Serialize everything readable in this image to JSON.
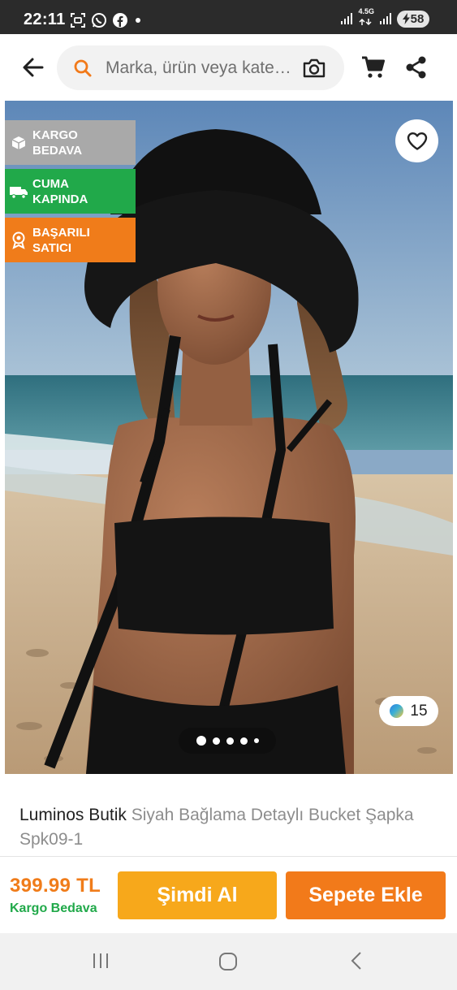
{
  "status_bar": {
    "time": "22:11",
    "network_label": "4.5G",
    "battery": "58",
    "icons": [
      "screenshot-icon",
      "whatsapp-icon",
      "facebook-icon",
      "dot-icon",
      "signal-icon",
      "network-icon",
      "battery-icon"
    ]
  },
  "header": {
    "search_placeholder": "Marka, ürün veya kategori ara",
    "icons": [
      "back-arrow-icon",
      "search-icon",
      "camera-icon",
      "cart-icon",
      "share-icon"
    ]
  },
  "badges": [
    {
      "label": "KARGO BEDAVA",
      "color": "#a9a9a9",
      "icon": "box-icon"
    },
    {
      "label": "CUMA KAPINDA",
      "color": "#21a94a",
      "icon": "truck-icon"
    },
    {
      "label": "BAŞARILI SATICI",
      "color": "#f07c1a",
      "icon": "award-icon"
    }
  ],
  "gallery": {
    "photo_count": "15",
    "pages": 5,
    "active_page": 1
  },
  "product": {
    "brand": "Luminos Butik",
    "name": "Siyah Bağlama Detaylı Bucket Şapka Spk09-1"
  },
  "action_bar": {
    "price": "399.99 TL",
    "shipping_note": "Kargo Bedava",
    "buy_now_label": "Şimdi Al",
    "add_to_cart_label": "Sepete Ekle"
  },
  "colors": {
    "accent_orange": "#f27a1a",
    "buy_now_yellow": "#f7a81b",
    "success_green": "#21a94a"
  }
}
